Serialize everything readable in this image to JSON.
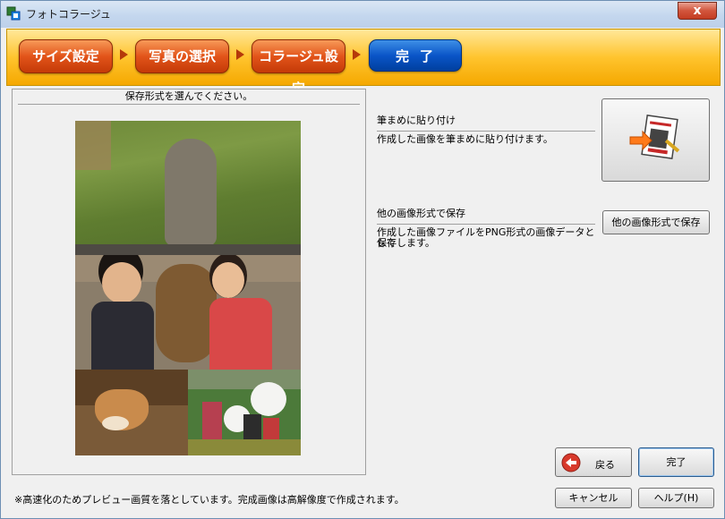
{
  "window": {
    "title": "フォトコラージュ",
    "close_glyph": "x"
  },
  "steps": [
    {
      "label": "サイズ設定"
    },
    {
      "label": "写真の選択"
    },
    {
      "label": "コラージュ設定"
    },
    {
      "label": "完了"
    }
  ],
  "preview": {
    "caption": "保存形式を選んでください。"
  },
  "options": {
    "fudemame": {
      "title": "筆まめに貼り付け",
      "description": "作成した画像を筆まめに貼り付けます。"
    },
    "other_format": {
      "title": "他の画像形式で保存",
      "description_line1": "作成した画像ファイルをPNG形式の画像データとして",
      "description_line2": "保存します。",
      "button_label": "他の画像形式で保存"
    }
  },
  "nav": {
    "back_label": "戻る",
    "finish_label": "完了"
  },
  "footer": {
    "note": "※高速化のためプレビュー画質を落としています。完成画像は高解像度で作成されます。",
    "cancel_label": "キャンセル",
    "help_label": "ヘルプ(H)"
  },
  "icons": {
    "app": "photo-collage-app-icon",
    "close": "close-icon",
    "paste": "fudemame-paste-icon",
    "back": "back-arrow-icon",
    "step_arrow": "step-arrow-icon"
  },
  "colors": {
    "step_active": "#e2541a",
    "step_current": "#0a55c8",
    "steps_bar": "#ffc42e",
    "close": "#c33c22",
    "back_icon": "#d8392b"
  }
}
